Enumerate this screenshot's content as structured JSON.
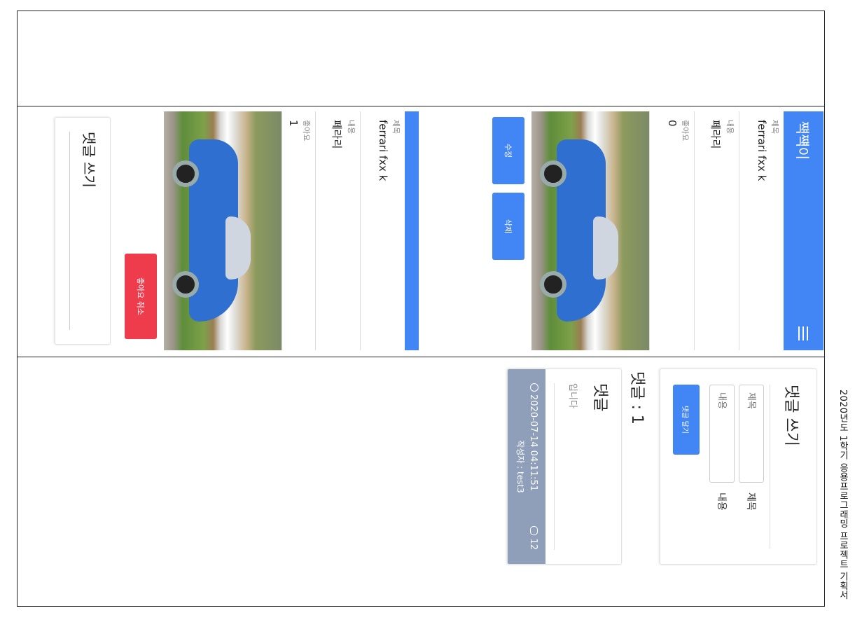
{
  "caption": "2020년도 1학기 응용프로그래밍 프로젝트 기획서",
  "detail_unliked": {
    "app_title": "쨱쨱이",
    "fields": [
      {
        "label": "제목",
        "value": "ferrari fxx k"
      },
      {
        "label": "내용",
        "value": "페라리"
      },
      {
        "label": "좋아요",
        "value": "0"
      }
    ],
    "edit_label": "수정",
    "delete_label": "삭제"
  },
  "detail_liked": {
    "fields": [
      {
        "label": "제목",
        "value": "ferrari fxx k"
      },
      {
        "label": "내용",
        "value": "페라리"
      },
      {
        "label": "좋아요",
        "value": "1"
      }
    ],
    "unlike_label": "좋아요 취소",
    "comment_card_title": "댓글 쓰기"
  },
  "comments": {
    "write_title": "댓글 쓰기",
    "title_placeholder": "제목",
    "title_label": "제목",
    "content_placeholder": "내용",
    "content_label": "내용",
    "submit_label": "댓글 달기",
    "count_text": "댓글 : 1",
    "item": {
      "title": "댓글",
      "body": "입니다",
      "timestamp": "2020-07-14 04:11:51",
      "reply_count": "12",
      "author": "작성자 : test3"
    }
  },
  "colors": {
    "primary": "#4285f4",
    "danger": "#ef3c4d",
    "footer": "#8f9fba"
  }
}
